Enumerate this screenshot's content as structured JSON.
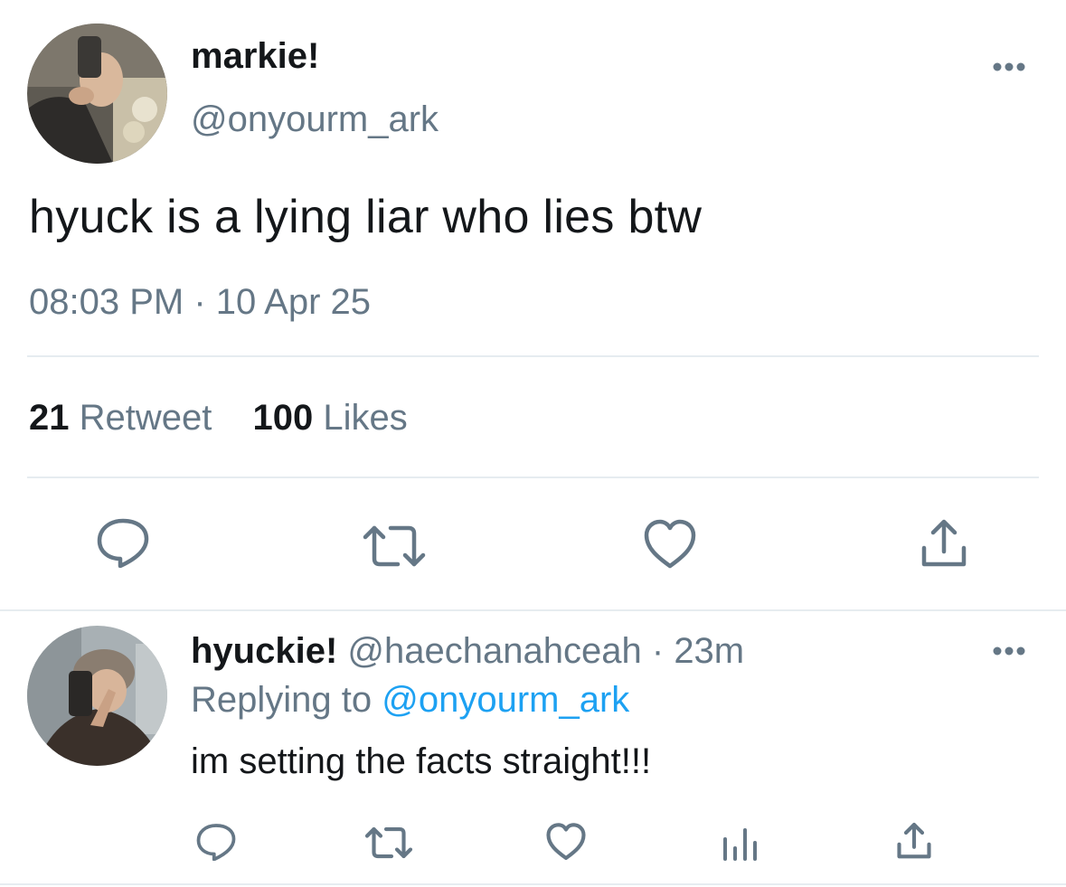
{
  "tweet": {
    "display_name": "markie!",
    "handle": "@onyourm_ark",
    "text": "hyuck is a lying liar who lies btw",
    "timestamp": "08:03 PM · 10 Apr 25",
    "retweet_count": "21",
    "retweet_label": "Retweet",
    "like_count": "100",
    "like_label": "Likes",
    "avatar_icon": "profile-photo",
    "more_icon": "more-dots-icon"
  },
  "actions": {
    "reply_icon": "reply-icon",
    "retweet_icon": "retweet-icon",
    "like_icon": "heart-icon",
    "share_icon": "share-icon",
    "analytics_icon": "analytics-icon"
  },
  "reply": {
    "display_name": "hyuckie!",
    "handle": "@haechanahceah",
    "separator": "·",
    "time_ago": "23m",
    "replying_prefix": "Replying to",
    "replying_to": "@onyourm_ark",
    "text": "im setting the facts straight!!!"
  },
  "colors": {
    "text_primary": "#14171a",
    "text_secondary": "#657786",
    "link": "#1da1f2",
    "divider": "#e6ecf0"
  }
}
